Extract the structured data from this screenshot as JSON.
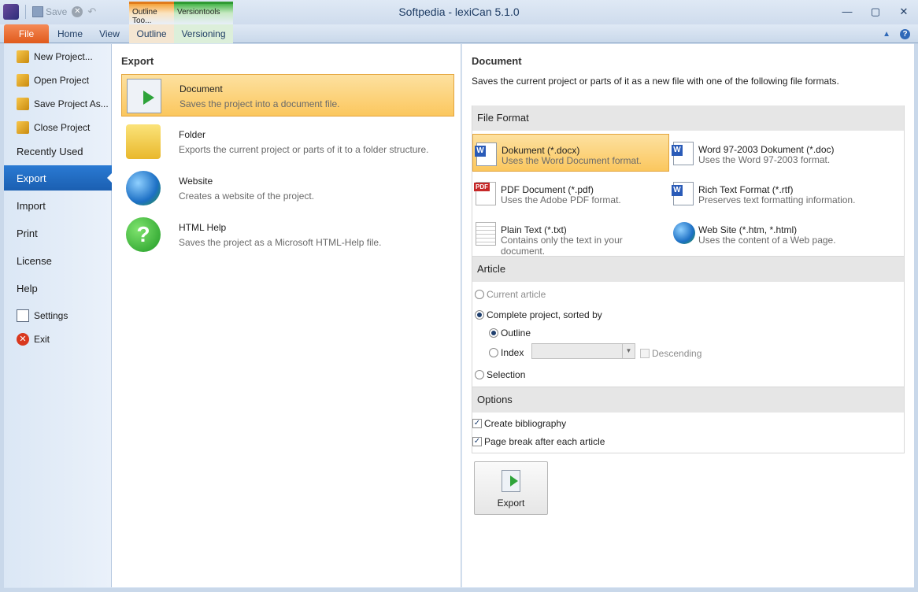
{
  "titlebar": {
    "title": "Softpedia - lexiCan 5.1.0",
    "qat_save": "Save",
    "context_outline": "Outline Too...",
    "context_version": "Versiontools"
  },
  "tabs": {
    "file": "File",
    "home": "Home",
    "view": "View",
    "outline": "Outline",
    "versioning": "Versioning"
  },
  "nav": {
    "new_project": "New Project...",
    "open_project": "Open Project",
    "save_project_as": "Save Project As...",
    "close_project": "Close Project",
    "recently_used": "Recently Used",
    "export": "Export",
    "import": "Import",
    "print": "Print",
    "license": "License",
    "help": "Help",
    "settings": "Settings",
    "exit": "Exit"
  },
  "export_panel": {
    "title": "Export",
    "items": [
      {
        "name": "Document",
        "desc": "Saves the project into a document file."
      },
      {
        "name": "Folder",
        "desc": "Exports the current project or parts of it to a folder structure."
      },
      {
        "name": "Website",
        "desc": "Creates a website of the project."
      },
      {
        "name": "HTML Help",
        "desc": "Saves the project as a Microsoft HTML-Help file."
      }
    ]
  },
  "document_panel": {
    "title": "Document",
    "desc": "Saves the current project or parts of it as a new file with one of the following file formats.",
    "file_format_header": "File Format",
    "formats": [
      {
        "name": "Dokument (*.docx)",
        "desc": "Uses the Word Document format."
      },
      {
        "name": "Word 97-2003 Dokument (*.doc)",
        "desc": "Uses the Word 97-2003 format."
      },
      {
        "name": "PDF Document (*.pdf)",
        "desc": "Uses the Adobe PDF format."
      },
      {
        "name": "Rich Text Format (*.rtf)",
        "desc": "Preserves text formatting information."
      },
      {
        "name": "Plain Text (*.txt)",
        "desc": "Contains only the text in your document."
      },
      {
        "name": "Web Site (*.htm, *.html)",
        "desc": "Uses the content of a Web page."
      }
    ],
    "article_header": "Article",
    "current_article": "Current article",
    "complete_project": "Complete project, sorted by",
    "outline": "Outline",
    "index": "Index",
    "descending": "Descending",
    "selection": "Selection",
    "options_header": "Options",
    "create_bibliography": "Create bibliography",
    "page_break": "Page break after each article",
    "export_button": "Export"
  }
}
